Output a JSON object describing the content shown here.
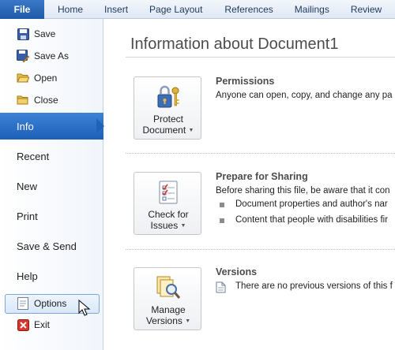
{
  "ribbon": {
    "file_tab": "File",
    "tabs": [
      "Home",
      "Insert",
      "Page Layout",
      "References",
      "Mailings",
      "Review"
    ]
  },
  "backstage": {
    "commands": [
      {
        "label": "Save",
        "icon": "save-icon"
      },
      {
        "label": "Save As",
        "icon": "save-as-icon"
      },
      {
        "label": "Open",
        "icon": "open-folder-icon"
      },
      {
        "label": "Close",
        "icon": "close-folder-icon"
      }
    ],
    "nav": [
      "Info",
      "Recent",
      "New",
      "Print",
      "Save & Send",
      "Help"
    ],
    "active_nav": "Info",
    "footer": [
      {
        "label": "Options",
        "icon": "options-icon"
      },
      {
        "label": "Exit",
        "icon": "exit-icon"
      }
    ]
  },
  "info": {
    "title": "Information about Document1",
    "permissions": {
      "button_line1": "Protect",
      "button_line2": "Document",
      "heading": "Permissions",
      "text": "Anyone can open, copy, and change any pa"
    },
    "sharing": {
      "button_line1": "Check for",
      "button_line2": "Issues",
      "heading": "Prepare for Sharing",
      "text": "Before sharing this file, be aware that it con",
      "items": [
        "Document properties and author's nar",
        "Content that people with disabilities fir"
      ]
    },
    "versions": {
      "button_line1": "Manage",
      "button_line2": "Versions",
      "heading": "Versions",
      "text": "There are no previous versions of this f"
    }
  },
  "colors": {
    "file_tab": "#2a6bbd",
    "active_nav": "#1f62b9",
    "ribbon_text": "#1e395b"
  }
}
